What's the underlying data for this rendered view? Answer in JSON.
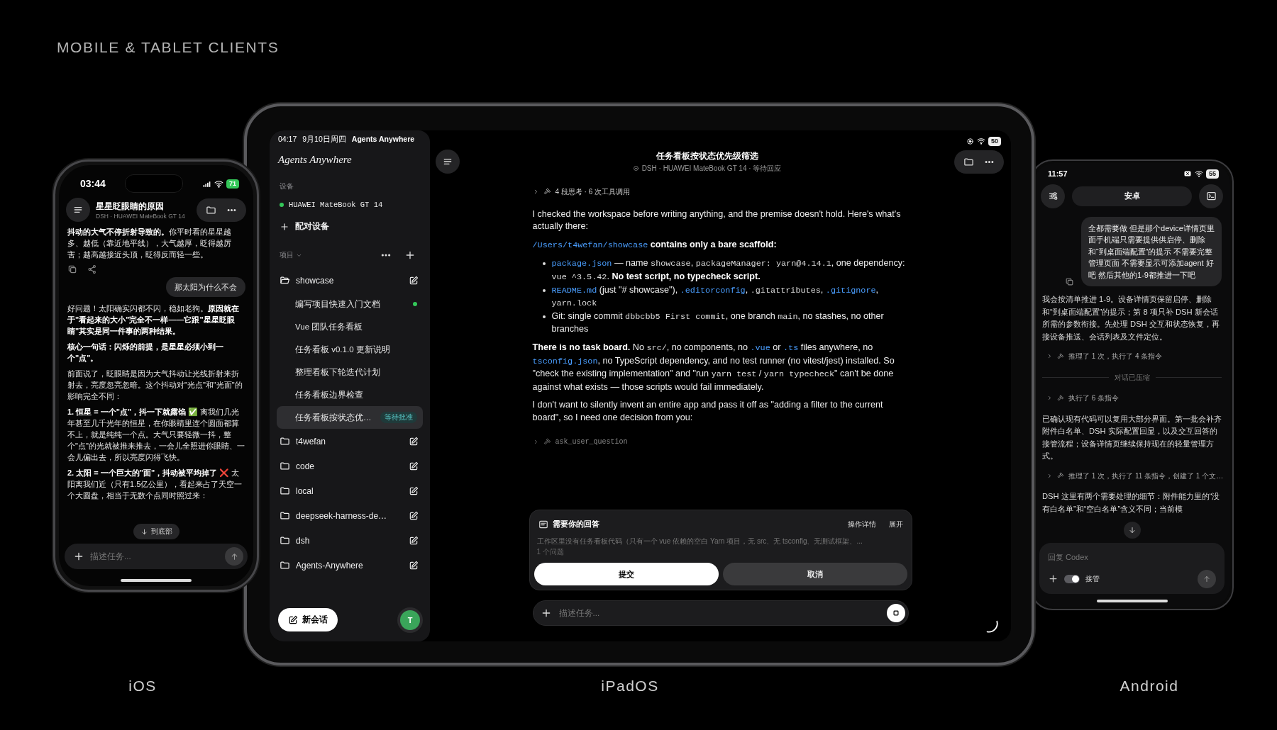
{
  "heading": "MOBILE & TABLET CLIENTS",
  "ios": {
    "label": "iOS",
    "status_bar": {
      "time": "03:44",
      "battery": "71"
    },
    "header": {
      "title": "星星眨眼睛的原因",
      "subtitle": "DSH · HUAWEI MateBook GT 14"
    },
    "messages": [
      {
        "kind": "assistant",
        "actions": true,
        "paragraphs": [
          {
            "text": "**抖动的大气不停折射导致的。**你平时看的星星越多、越低（靠近地平线），大气越厚，眨得越厉害；越高越接近头顶，眨得反而轻一些。",
            "strong": false
          }
        ]
      },
      {
        "kind": "user",
        "text": "那太阳为什么不会"
      },
      {
        "kind": "assistant",
        "actions": false,
        "paragraphs": [
          {
            "text": "好问题！太阳确实闪都不闪，稳如老狗。**原因就在于\"看起来的大小\"完全不一样——它跟\"星星眨眼睛\"其实是同一件事的两种结果。**",
            "strong": false
          },
          {
            "text": "核心一句话：闪烁的前提，是星星必须小到一个\"点\"。",
            "strong": true
          },
          {
            "text": "前面说了，眨眼睛是因为大气抖动让光线折射来折射去，亮度忽亮忽暗。这个抖动对\"光点\"和\"光面\"的影响完全不同：",
            "strong": false
          },
          {
            "text": "**1. 恒星 = 一个\"点\"，抖一下就露馅** ✅ 离我们几光年甚至几千光年的恒星，在你眼睛里连个圆面都算不上，就是纯纯一个点。大气只要轻微一抖，整个\"点\"的光就被推来推去，一会儿全照进你眼睛、一会儿偏出去，所以亮度闪得飞快。",
            "strong": false
          },
          {
            "text": "**2. 太阳 = 一个巨大的\"面\"，抖动被平均掉了** ❌ 太阳离我们近（只有1.5亿公里），看起来占了天空一个大圆盘，相当于无数个点同时照过来：",
            "strong": false
          }
        ]
      }
    ],
    "scroll_button": "到底部",
    "composer": {
      "placeholder": "描述任务..."
    }
  },
  "ipad": {
    "label": "iPadOS",
    "status_bar": {
      "time": "04:17",
      "date": "9月10日周四",
      "app": "Agents Anywhere",
      "battery": "50"
    },
    "sidebar": {
      "logo": "Agents Anywhere",
      "devices_label": "设备",
      "devices": [
        {
          "name": "HUAWEI MateBook GT 14",
          "color": "#34c759"
        }
      ],
      "pair_button": "配对设备",
      "projects_label": "项目",
      "projects": [
        {
          "name": "showcase",
          "expanded": true,
          "sessions": [
            {
              "title": "编写项目快速入门文档",
              "active": true,
              "selected": false
            },
            {
              "title": "Vue 团队任务看板",
              "active": false,
              "selected": false
            },
            {
              "title": "任务看板 v0.1.0 更新说明",
              "active": false,
              "selected": false
            },
            {
              "title": "整理看板下轮迭代计划",
              "active": false,
              "selected": false
            },
            {
              "title": "任务看板边界检查",
              "active": false,
              "selected": false
            },
            {
              "title": "任务看板按状态优…",
              "active": false,
              "selected": true,
              "badge": "等待批准"
            }
          ]
        },
        {
          "name": "t4wefan",
          "expanded": false
        },
        {
          "name": "code",
          "expanded": false
        },
        {
          "name": "local",
          "expanded": false
        },
        {
          "name": "deepseek-harness-de…",
          "expanded": false
        },
        {
          "name": "dsh",
          "expanded": false
        },
        {
          "name": "Agents-Anywhere",
          "expanded": false
        }
      ],
      "new_chat_button": "新会话",
      "avatar": "T"
    },
    "header": {
      "title": "任务看板按状态优先级筛选",
      "subtitle": "DSH · HUAWEI MateBook GT 14 · 等待回应"
    },
    "blocks": [
      {
        "kind": "tool",
        "text": "4 段思考 · 6 次工具调用"
      },
      {
        "kind": "paragraph",
        "segments": [
          {
            "kind": "plain",
            "text": "I checked the workspace before writing anything, and the premise doesn't hold. Here's what's actually there:"
          }
        ]
      },
      {
        "kind": "paragraph",
        "segments": [
          {
            "kind": "link",
            "text": "/Users/t4wefan/showcase"
          },
          {
            "kind": "strong",
            "text": " contains only a bare scaffold:"
          }
        ]
      },
      {
        "kind": "list",
        "items": [
          [
            {
              "kind": "link",
              "text": "package.json"
            },
            {
              "kind": "plain",
              "text": " — name "
            },
            {
              "kind": "code",
              "text": "showcase"
            },
            {
              "kind": "plain",
              "text": ", "
            },
            {
              "kind": "code",
              "text": "packageManager: yarn@4.14.1"
            },
            {
              "kind": "plain",
              "text": ", one dependency: "
            },
            {
              "kind": "code",
              "text": "vue ^3.5.42"
            },
            {
              "kind": "plain",
              "text": ". "
            },
            {
              "kind": "strong",
              "text": "No test script, no typecheck script."
            }
          ],
          [
            {
              "kind": "link",
              "text": "README.md"
            },
            {
              "kind": "plain",
              "text": " (just \"# showcase\"), "
            },
            {
              "kind": "link",
              "text": ".editorconfig"
            },
            {
              "kind": "plain",
              "text": ", "
            },
            {
              "kind": "code",
              "text": ".gitattributes"
            },
            {
              "kind": "plain",
              "text": ", "
            },
            {
              "kind": "link",
              "text": ".gitignore"
            },
            {
              "kind": "plain",
              "text": ", "
            },
            {
              "kind": "code",
              "text": "yarn.lock"
            }
          ],
          [
            {
              "kind": "plain",
              "text": "Git: single commit "
            },
            {
              "kind": "code",
              "text": "dbbcbb5 First commit"
            },
            {
              "kind": "plain",
              "text": ", one branch "
            },
            {
              "kind": "code",
              "text": "main"
            },
            {
              "kind": "plain",
              "text": ", no stashes, no other branches"
            }
          ]
        ]
      },
      {
        "kind": "paragraph",
        "segments": [
          {
            "kind": "strong",
            "text": "There is no task board."
          },
          {
            "kind": "plain",
            "text": " No "
          },
          {
            "kind": "code",
            "text": "src/"
          },
          {
            "kind": "plain",
            "text": ", no components, no "
          },
          {
            "kind": "link",
            "text": ".vue"
          },
          {
            "kind": "plain",
            "text": " or "
          },
          {
            "kind": "link",
            "text": ".ts"
          },
          {
            "kind": "plain",
            "text": " files anywhere, no "
          },
          {
            "kind": "link",
            "text": "tsconfig.json"
          },
          {
            "kind": "plain",
            "text": ", no TypeScript dependency, and no test runner (no vitest/jest) installed. So \"check the existing implementation\" and \"run "
          },
          {
            "kind": "code",
            "text": "yarn test"
          },
          {
            "kind": "plain",
            "text": " / "
          },
          {
            "kind": "code",
            "text": "yarn typecheck"
          },
          {
            "kind": "plain",
            "text": "\" can't be done against what exists — those scripts would fail immediately."
          }
        ]
      },
      {
        "kind": "paragraph",
        "segments": [
          {
            "kind": "plain",
            "text": "I don't want to silently invent an entire app and pass it off as \"adding a filter to the current board\", so I need one decision from you:"
          }
        ]
      },
      {
        "kind": "tool_call",
        "text": "ask_user_question"
      }
    ],
    "question": {
      "title": "需要你的回答",
      "actions": [
        "操作详情",
        "展开"
      ],
      "summary": "工作区里没有任务看板代码（只有一个 vue 依赖的空白 Yarn 项目，无 src、无 tsconfig、无测试框架、...",
      "count": "1 个问题",
      "buttons": [
        {
          "label": "提交",
          "kind": "primary"
        },
        {
          "label": "取消",
          "kind": "secondary"
        }
      ]
    },
    "composer": {
      "placeholder": "描述任务..."
    }
  },
  "android": {
    "label": "Android",
    "status_bar": {
      "time": "11:57",
      "battery": "55"
    },
    "header": {
      "title": "安卓"
    },
    "messages": [
      {
        "kind": "user",
        "text": "全都需要做  但是那个device详情页里面手机端只需要提供供启停、删除和“到桌面端配置”的提示  不需要完整管理页面 不需要显示可添加agent   好吧    然后其他的1-9都推进一下吧"
      },
      {
        "kind": "text",
        "text": "我会按清单推进 1-9。设备详情页保留启停、删除和“到桌面端配置”的提示；第 8 项只补 DSH 新会话所需的参数衔接。先处理 DSH 交互和状态恢复，再接设备推送、会话列表及文件定位。"
      },
      {
        "kind": "tool",
        "text": "推理了 1 次，执行了 4 条指令"
      },
      {
        "kind": "divider",
        "text": "对话已压缩"
      },
      {
        "kind": "tool",
        "text": "执行了 6 条指令"
      },
      {
        "kind": "text",
        "text": "已确认现有代码可以复用大部分界面。第一批会补齐附件白名单、DSH 实际配置回显，以及交互回答的接管流程；设备详情页继续保持现在的轻量管理方式。"
      },
      {
        "kind": "tool",
        "text": "推理了 1 次，执行了 11 条指令，创建了 1 个文…"
      },
      {
        "kind": "text",
        "text": "DSH 这里有两个需要处理的细节：附件能力里的“没有白名单”和“空白名单”含义不同；当前模"
      }
    ],
    "composer": {
      "placeholder": "回复 Codex",
      "toggle": {
        "label": "接管",
        "on": true
      }
    }
  }
}
